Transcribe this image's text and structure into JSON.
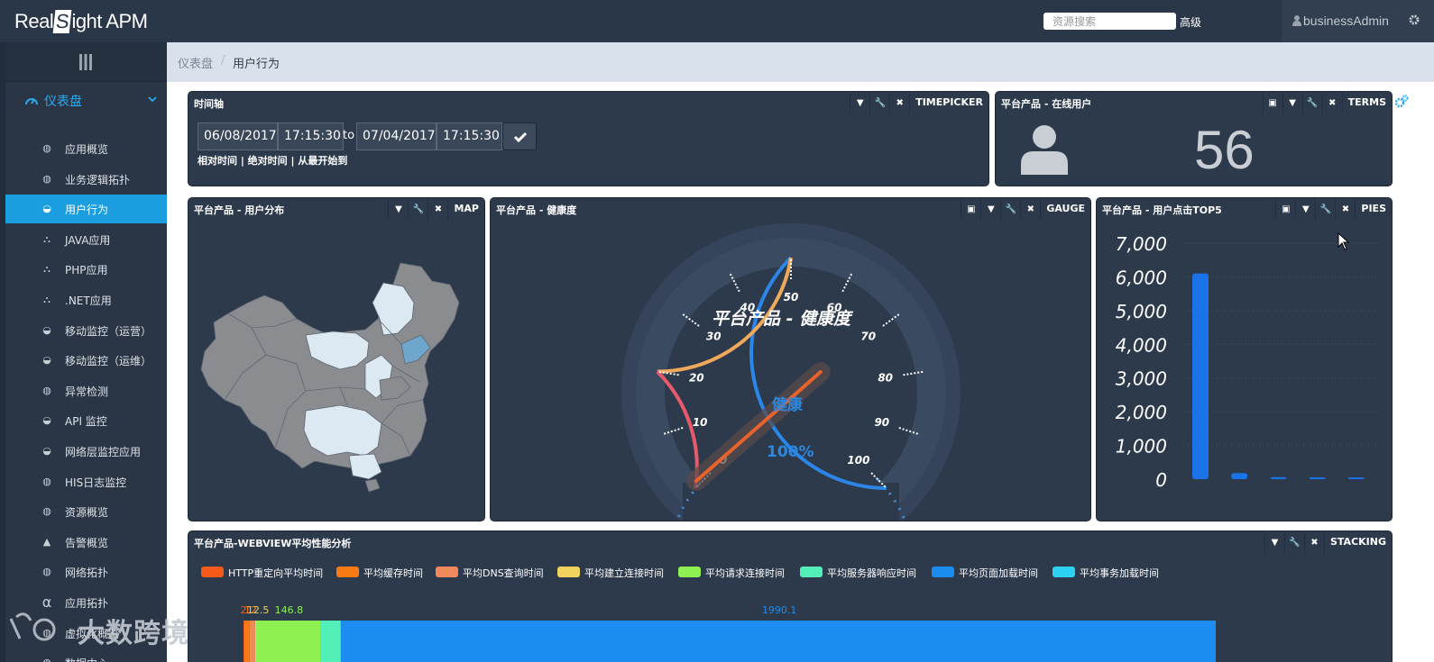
{
  "app": {
    "title": "RealSight APM",
    "logo_pre": "Real",
    "logo_s": "S",
    "logo_post": "ight APM"
  },
  "topbar": {
    "search_placeholder": "资源搜索",
    "advanced_label": "高级",
    "user": "businessAdmin"
  },
  "sidebar": {
    "dashboard_label": "仪表盘",
    "items": [
      {
        "label": "应用概览",
        "icon": "globe-icon"
      },
      {
        "label": "业务逻辑拓扑",
        "icon": "globe-icon"
      },
      {
        "label": "用户行为",
        "icon": "dashboard-icon",
        "active": true
      },
      {
        "label": "JAVA应用",
        "icon": "sitemap-icon"
      },
      {
        "label": "PHP应用",
        "icon": "sitemap-icon"
      },
      {
        "label": ".NET应用",
        "icon": "sitemap-icon"
      },
      {
        "label": "移动监控（运营）",
        "icon": "dashboard-icon"
      },
      {
        "label": "移动监控（运维）",
        "icon": "dashboard-icon"
      },
      {
        "label": "异常检测",
        "icon": "globe-icon"
      },
      {
        "label": "API 监控",
        "icon": "dashboard-icon"
      },
      {
        "label": "网络层监控应用",
        "icon": "dashboard-icon"
      },
      {
        "label": "HIS日志监控",
        "icon": "globe-icon"
      },
      {
        "label": "资源概览",
        "icon": "globe-icon"
      },
      {
        "label": "告警概览",
        "icon": "warning-icon"
      },
      {
        "label": "网络拓扑",
        "icon": "globe-icon"
      },
      {
        "label": "应用拓扑",
        "icon": "alpha-icon"
      },
      {
        "label": "虚拟化概览",
        "icon": "globe-icon"
      },
      {
        "label": "数据中心",
        "icon": "globe-icon"
      }
    ]
  },
  "breadcrumb": {
    "root": "仪表盘",
    "sep": "/",
    "current": "用户行为"
  },
  "panels": {
    "timepicker": {
      "title": "时间轴",
      "type": "TIMEPICKER",
      "from_date": "06/08/2017",
      "from_time": "17:15:30",
      "to_label": "to",
      "to_date": "07/04/2017",
      "to_time": "17:15:30",
      "links": "相对时间 | 绝对时间 | 从最开始到"
    },
    "online": {
      "title": "平台产品 - 在线用户",
      "type": "TERMS",
      "value": "56"
    },
    "map": {
      "title": "平台产品 - 用户分布",
      "type": "MAP"
    },
    "gauge": {
      "title": "平台产品 - 健康度",
      "type": "GAUGE",
      "label": "平台产品 - 健康度",
      "status": "健康",
      "value": "100%",
      "ticks": [
        "0",
        "10",
        "20",
        "30",
        "40",
        "50",
        "60",
        "70",
        "80",
        "90",
        "100"
      ]
    },
    "top5": {
      "title": "平台产品 - 用户点击TOP5",
      "type": "PIES"
    },
    "stacking": {
      "title": "平台产品-WEBVIEW平均性能分析",
      "type": "STACKING"
    }
  },
  "chart_data": [
    {
      "type": "bar",
      "ylim": [
        0,
        7000
      ],
      "yticks": [
        "0",
        "1,000",
        "2,000",
        "3,000",
        "4,000",
        "5,000",
        "6,000",
        "7,000"
      ],
      "values": [
        6100,
        180,
        60,
        25,
        15
      ],
      "color": "#1a73e8"
    },
    {
      "type": "bar",
      "orientation": "horizontal-stacked",
      "series": [
        {
          "name": "HTTP重定向平均时间",
          "color": "#f45a1a",
          "value": 2
        },
        {
          "name": "平均缓存时间",
          "color": "#f77b12",
          "value": 12
        },
        {
          "name": "平均DNS查询时间",
          "color": "#f08a5a",
          "value": 12.5
        },
        {
          "name": "平均建立连接时间",
          "color": "#f1d25e",
          "value": 2
        },
        {
          "name": "平均请求连接时间",
          "color": "#8ff052",
          "value": 146.8
        },
        {
          "name": "平均服务器响应时间",
          "color": "#52f0b8",
          "value": 46
        },
        {
          "name": "平均页面加载时间",
          "color": "#1d8cf0",
          "value": 1990.1
        },
        {
          "name": "平均事务加载时间",
          "color": "#2cd0f0",
          "value": 0
        }
      ],
      "labels": [
        "2",
        "12",
        "12.5",
        "146.8",
        "1990.1"
      ]
    }
  ],
  "watermark": "大数跨境"
}
